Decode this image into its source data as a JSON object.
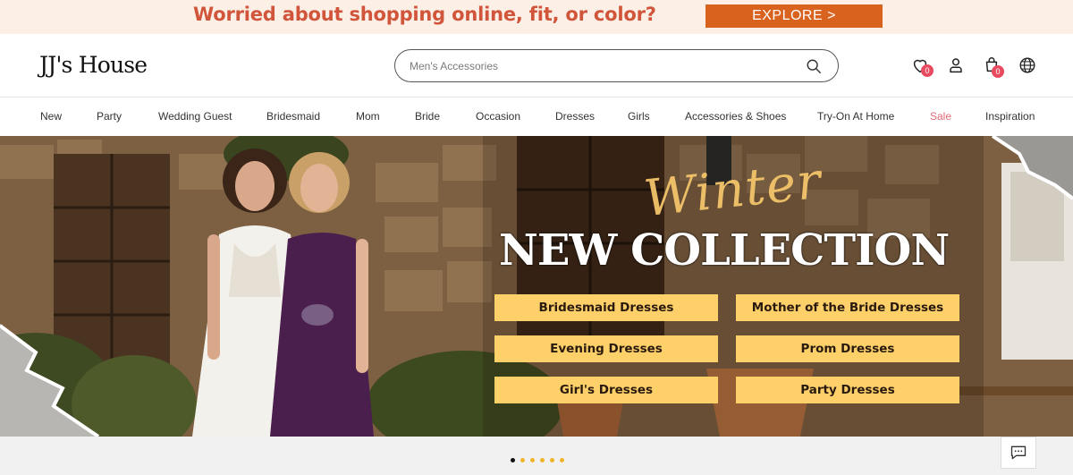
{
  "promo": {
    "text": "Worried about shopping online, fit, or color?",
    "button_label": "EXPLORE >"
  },
  "header": {
    "logo": "JJ's House",
    "search_placeholder": "Men's Accessories",
    "wishlist_count": "0",
    "cart_count": "0"
  },
  "nav": {
    "items": [
      "New",
      "Party",
      "Wedding Guest",
      "Bridesmaid",
      "Mom",
      "Bride",
      "Occasion",
      "Dresses",
      "Girls",
      "Accessories & Shoes",
      "Try-On At Home",
      "Sale",
      "Inspiration"
    ]
  },
  "hero": {
    "script_title": "Winter",
    "main_title": "NEW COLLECTION",
    "buttons": [
      "Bridesmaid Dresses",
      "Mother of the Bride Dresses",
      "Evening Dresses",
      "Prom Dresses",
      "Girl's Dresses",
      "Party Dresses"
    ]
  },
  "carousel": {
    "total": 6,
    "active": 1
  },
  "colors": {
    "promo_bg": "#fbefe6",
    "promo_text": "#d0553a",
    "explore_button": "#d9621f",
    "sale": "#e26a75",
    "cta_bg": "#fdd06a",
    "badge": "#e84a5f"
  },
  "icons": [
    "search-icon",
    "heart-icon",
    "user-icon",
    "cart-icon",
    "globe-icon",
    "chat-icon"
  ]
}
